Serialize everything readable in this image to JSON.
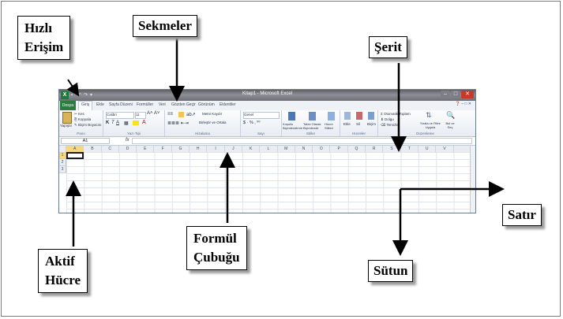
{
  "annotations": {
    "quick_access": [
      "Hızlı",
      "Erişim"
    ],
    "tabs_label": "Sekmeler",
    "ribbon_label": "Şerit",
    "row_label": "Satır",
    "formula_bar_label": [
      "Formül",
      "Çubuğu"
    ],
    "active_cell_label": [
      "Aktif",
      "Hücre"
    ],
    "column_label": "Sütun"
  },
  "excel": {
    "title": "Kitap1 - Microsoft Excel",
    "file_tab": "Dosya",
    "tabs": [
      "Giriş",
      "Ekle",
      "Sayfa Düzeni",
      "Formüller",
      "Veri",
      "Gözden Geçir",
      "Görünüm",
      "Eklentiler"
    ],
    "ribbon": {
      "pano": {
        "label": "Pano",
        "paste": "Yapıştır",
        "cut": "Kes",
        "copy": "Kopyala",
        "format_painter": "Biçim Boyacısı"
      },
      "font": {
        "label": "Yazı Tipi",
        "family": "Calibri",
        "size": "11"
      },
      "alignment": {
        "label": "Hizalama",
        "wrap": "Metni Kaydır",
        "merge": "Birleştir ve Ortala"
      },
      "number": {
        "label": "Sayı",
        "format": "Genel"
      },
      "styles": {
        "label": "Stiller",
        "cond": "Koşullu Biçimlendirme",
        "table": "Tablo Olarak Biçimlendir",
        "cell": "Hücre Stilleri"
      },
      "cells": {
        "label": "Hücreler",
        "insert": "Ekle",
        "delete": "Sil",
        "format": "Biçim"
      },
      "editing": {
        "label": "Düzenleme",
        "autosum": "Otomatik Toplam",
        "fill": "Dolgu",
        "clear": "Temizle",
        "sort": "Sırala ve Filtre Uygula",
        "find": "Bul ve Seç"
      }
    },
    "name_box": "A1",
    "fx": "fx",
    "columns": [
      "A",
      "B",
      "C",
      "D",
      "E",
      "F",
      "G",
      "H",
      "I",
      "J",
      "K",
      "L",
      "M",
      "N",
      "O",
      "P",
      "Q",
      "R",
      "S",
      "T",
      "U",
      "V"
    ],
    "rows": [
      "1",
      "2",
      "3"
    ]
  }
}
